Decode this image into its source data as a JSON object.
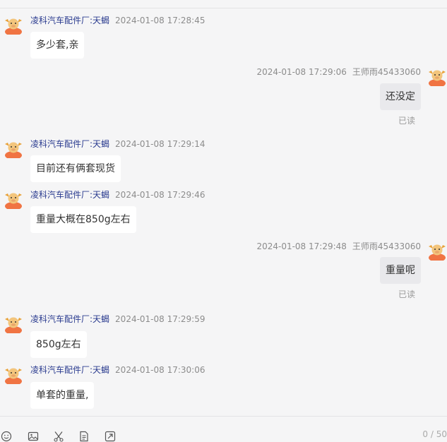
{
  "messages": [
    {
      "dir": "in",
      "sender": "凌科汽车配件厂:天蝎",
      "time": "2024-01-08 17:28:45",
      "text": "多少套,亲"
    },
    {
      "dir": "out",
      "sender": "王师雨45433060",
      "time": "2024-01-08 17:29:06",
      "text": "还没定",
      "status": "已读"
    },
    {
      "dir": "in",
      "sender": "凌科汽车配件厂:天蝎",
      "time": "2024-01-08 17:29:14",
      "text": "目前还有俩套现货"
    },
    {
      "dir": "in",
      "sender": "凌科汽车配件厂:天蝎",
      "time": "2024-01-08 17:29:46",
      "text": "重量大概在850g左右"
    },
    {
      "dir": "out",
      "sender": "王师雨45433060",
      "time": "2024-01-08 17:29:48",
      "text": "重量呢",
      "status": "已读"
    },
    {
      "dir": "in",
      "sender": "凌科汽车配件厂:天蝎",
      "time": "2024-01-08 17:29:59",
      "text": "850g左右"
    },
    {
      "dir": "in",
      "sender": "凌科汽车配件厂:天蝎",
      "time": "2024-01-08 17:30:06",
      "text": "单套的重量,"
    }
  ],
  "toolbar": {
    "icons": [
      "emoji-icon",
      "image-icon",
      "scissors-icon",
      "document-icon",
      "share-icon"
    ],
    "char_counter": "0 / 50"
  },
  "colors": {
    "background": "#f5f5f6",
    "incoming_bubble": "#ffffff",
    "outgoing_bubble": "#e9e9ec",
    "sender": "#2a3b8f"
  }
}
